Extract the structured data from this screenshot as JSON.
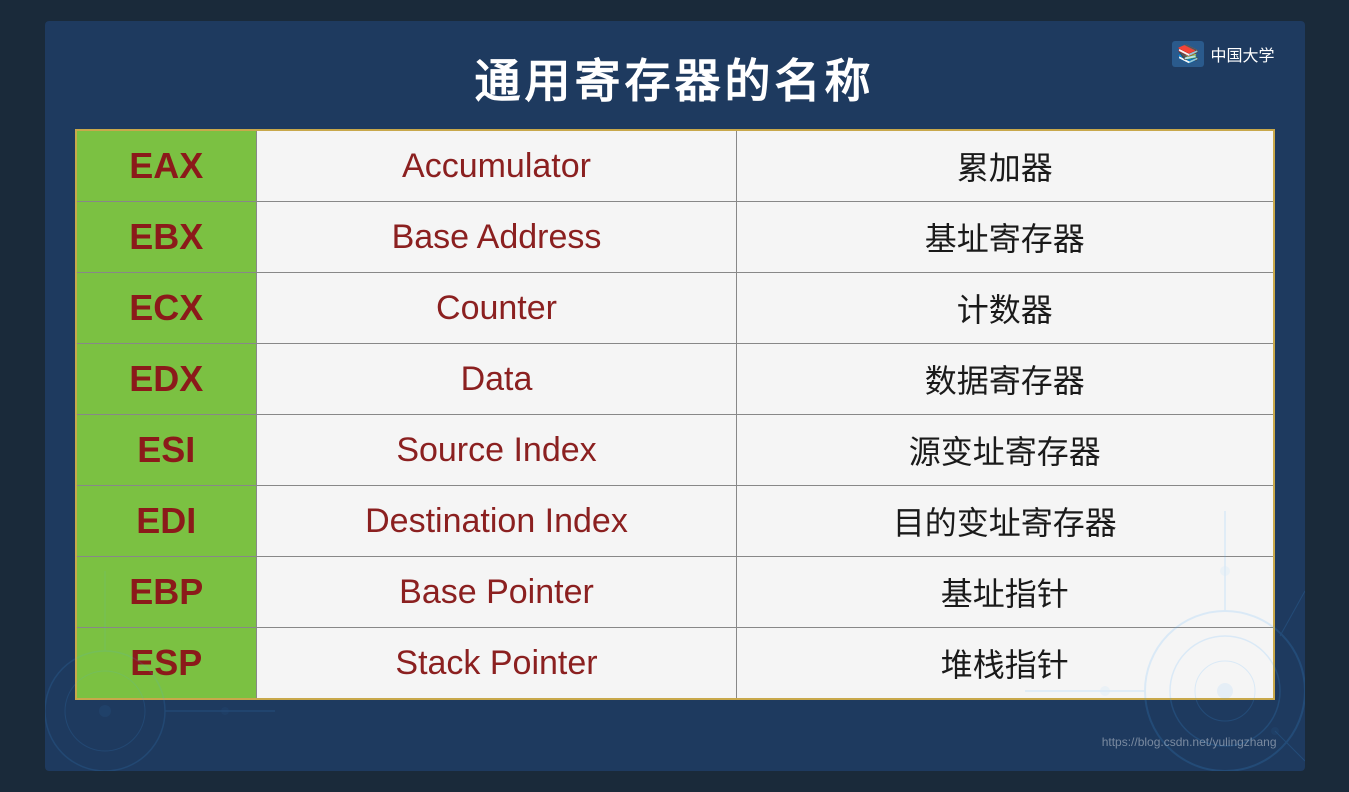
{
  "page": {
    "title": "通用寄存器的名称",
    "logo_text": "中国大学",
    "watermark": "https://blog.csdn.net/yulingzhang"
  },
  "table": {
    "rows": [
      {
        "reg": "EAX",
        "name": "Accumulator",
        "cn": "累加器"
      },
      {
        "reg": "EBX",
        "name": "Base Address",
        "cn": "基址寄存器"
      },
      {
        "reg": "ECX",
        "name": "Counter",
        "cn": "计数器"
      },
      {
        "reg": "EDX",
        "name": "Data",
        "cn": "数据寄存器"
      },
      {
        "reg": "ESI",
        "name": "Source Index",
        "cn": "源变址寄存器"
      },
      {
        "reg": "EDI",
        "name": "Destination Index",
        "cn": "目的变址寄存器"
      },
      {
        "reg": "EBP",
        "name": "Base Pointer",
        "cn": "基址指针"
      },
      {
        "reg": "ESP",
        "name": "Stack Pointer",
        "cn": "堆栈指针"
      }
    ]
  }
}
